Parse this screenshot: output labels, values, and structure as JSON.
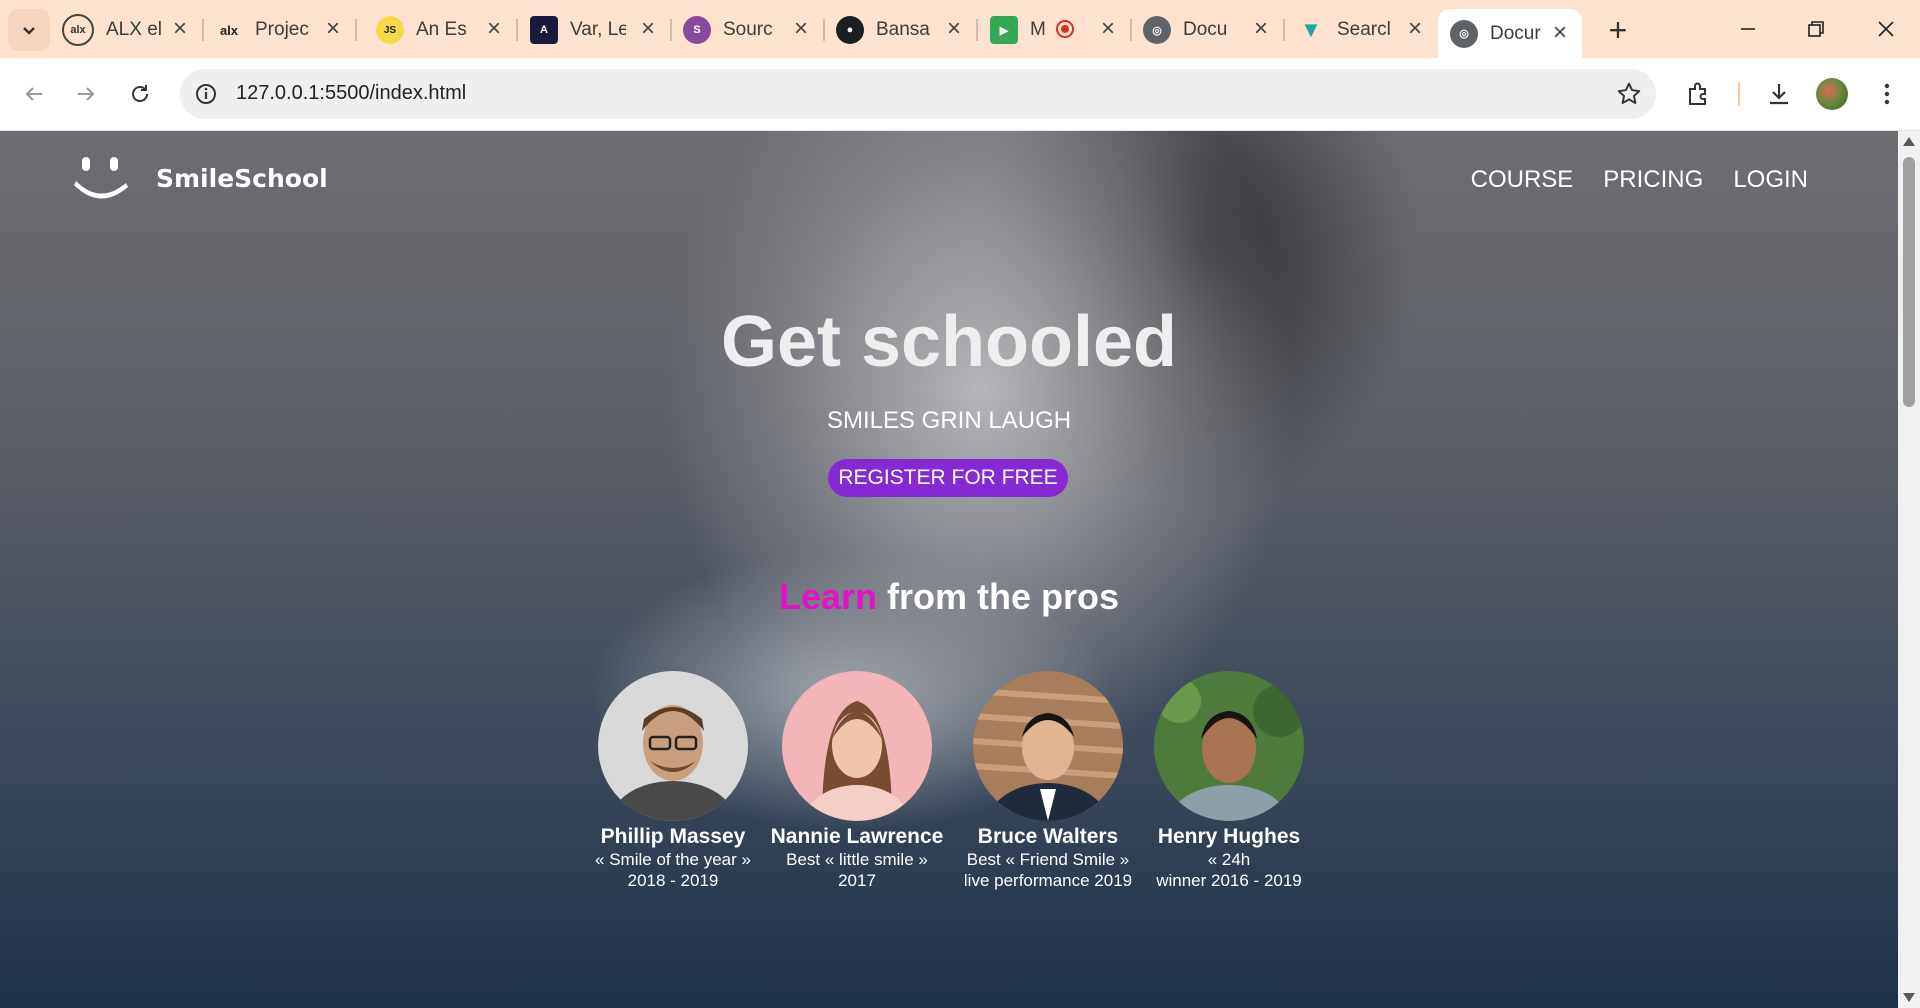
{
  "browser": {
    "tabs": [
      {
        "title": "ALX el",
        "favicon": "alx-icon"
      },
      {
        "title": "Projec",
        "favicon": "alx-icon"
      },
      {
        "title": "An Es",
        "favicon": "js-icon"
      },
      {
        "title": "Var, Le",
        "favicon": "letter-a-icon"
      },
      {
        "title": "Sourc",
        "favicon": "source-icon"
      },
      {
        "title": "Bansa",
        "favicon": "github-icon"
      },
      {
        "title": "M",
        "favicon": "meet-icon"
      },
      {
        "title": "Docu",
        "favicon": "globe-icon"
      },
      {
        "title": "Searcl",
        "favicon": "vuetify-icon"
      },
      {
        "title": "Docur",
        "favicon": "globe-icon",
        "active": true
      }
    ],
    "url": "127.0.0.1:5500/index.html"
  },
  "site": {
    "brand": "SmileSchool",
    "nav": [
      "COURSE",
      "PRICING",
      "LOGIN"
    ],
    "hero": {
      "title": "Get schooled",
      "subtitle": "SMILES GRIN LAUGH",
      "cta": "REGISTER FOR FREE"
    },
    "pros_title_accent": "Learn",
    "pros_title_rest": " from the pros",
    "pros": [
      {
        "name": "Phillip Massey",
        "line1": "« Smile of the year »",
        "line2": "2018 - 2019"
      },
      {
        "name": "Nannie Lawrence",
        "line1": "Best « little smile »",
        "line2": "2017"
      },
      {
        "name": "Bruce Walters",
        "line1": "Best « Friend Smile »",
        "line2": "live performance 2019"
      },
      {
        "name": "Henry Hughes",
        "line1": "« 24h",
        "line2": "winner 2016 - 2019"
      }
    ]
  },
  "colors": {
    "accent_purple": "#8629d4",
    "accent_magenta": "#e612c8",
    "tabstrip": "#fde3cf"
  }
}
